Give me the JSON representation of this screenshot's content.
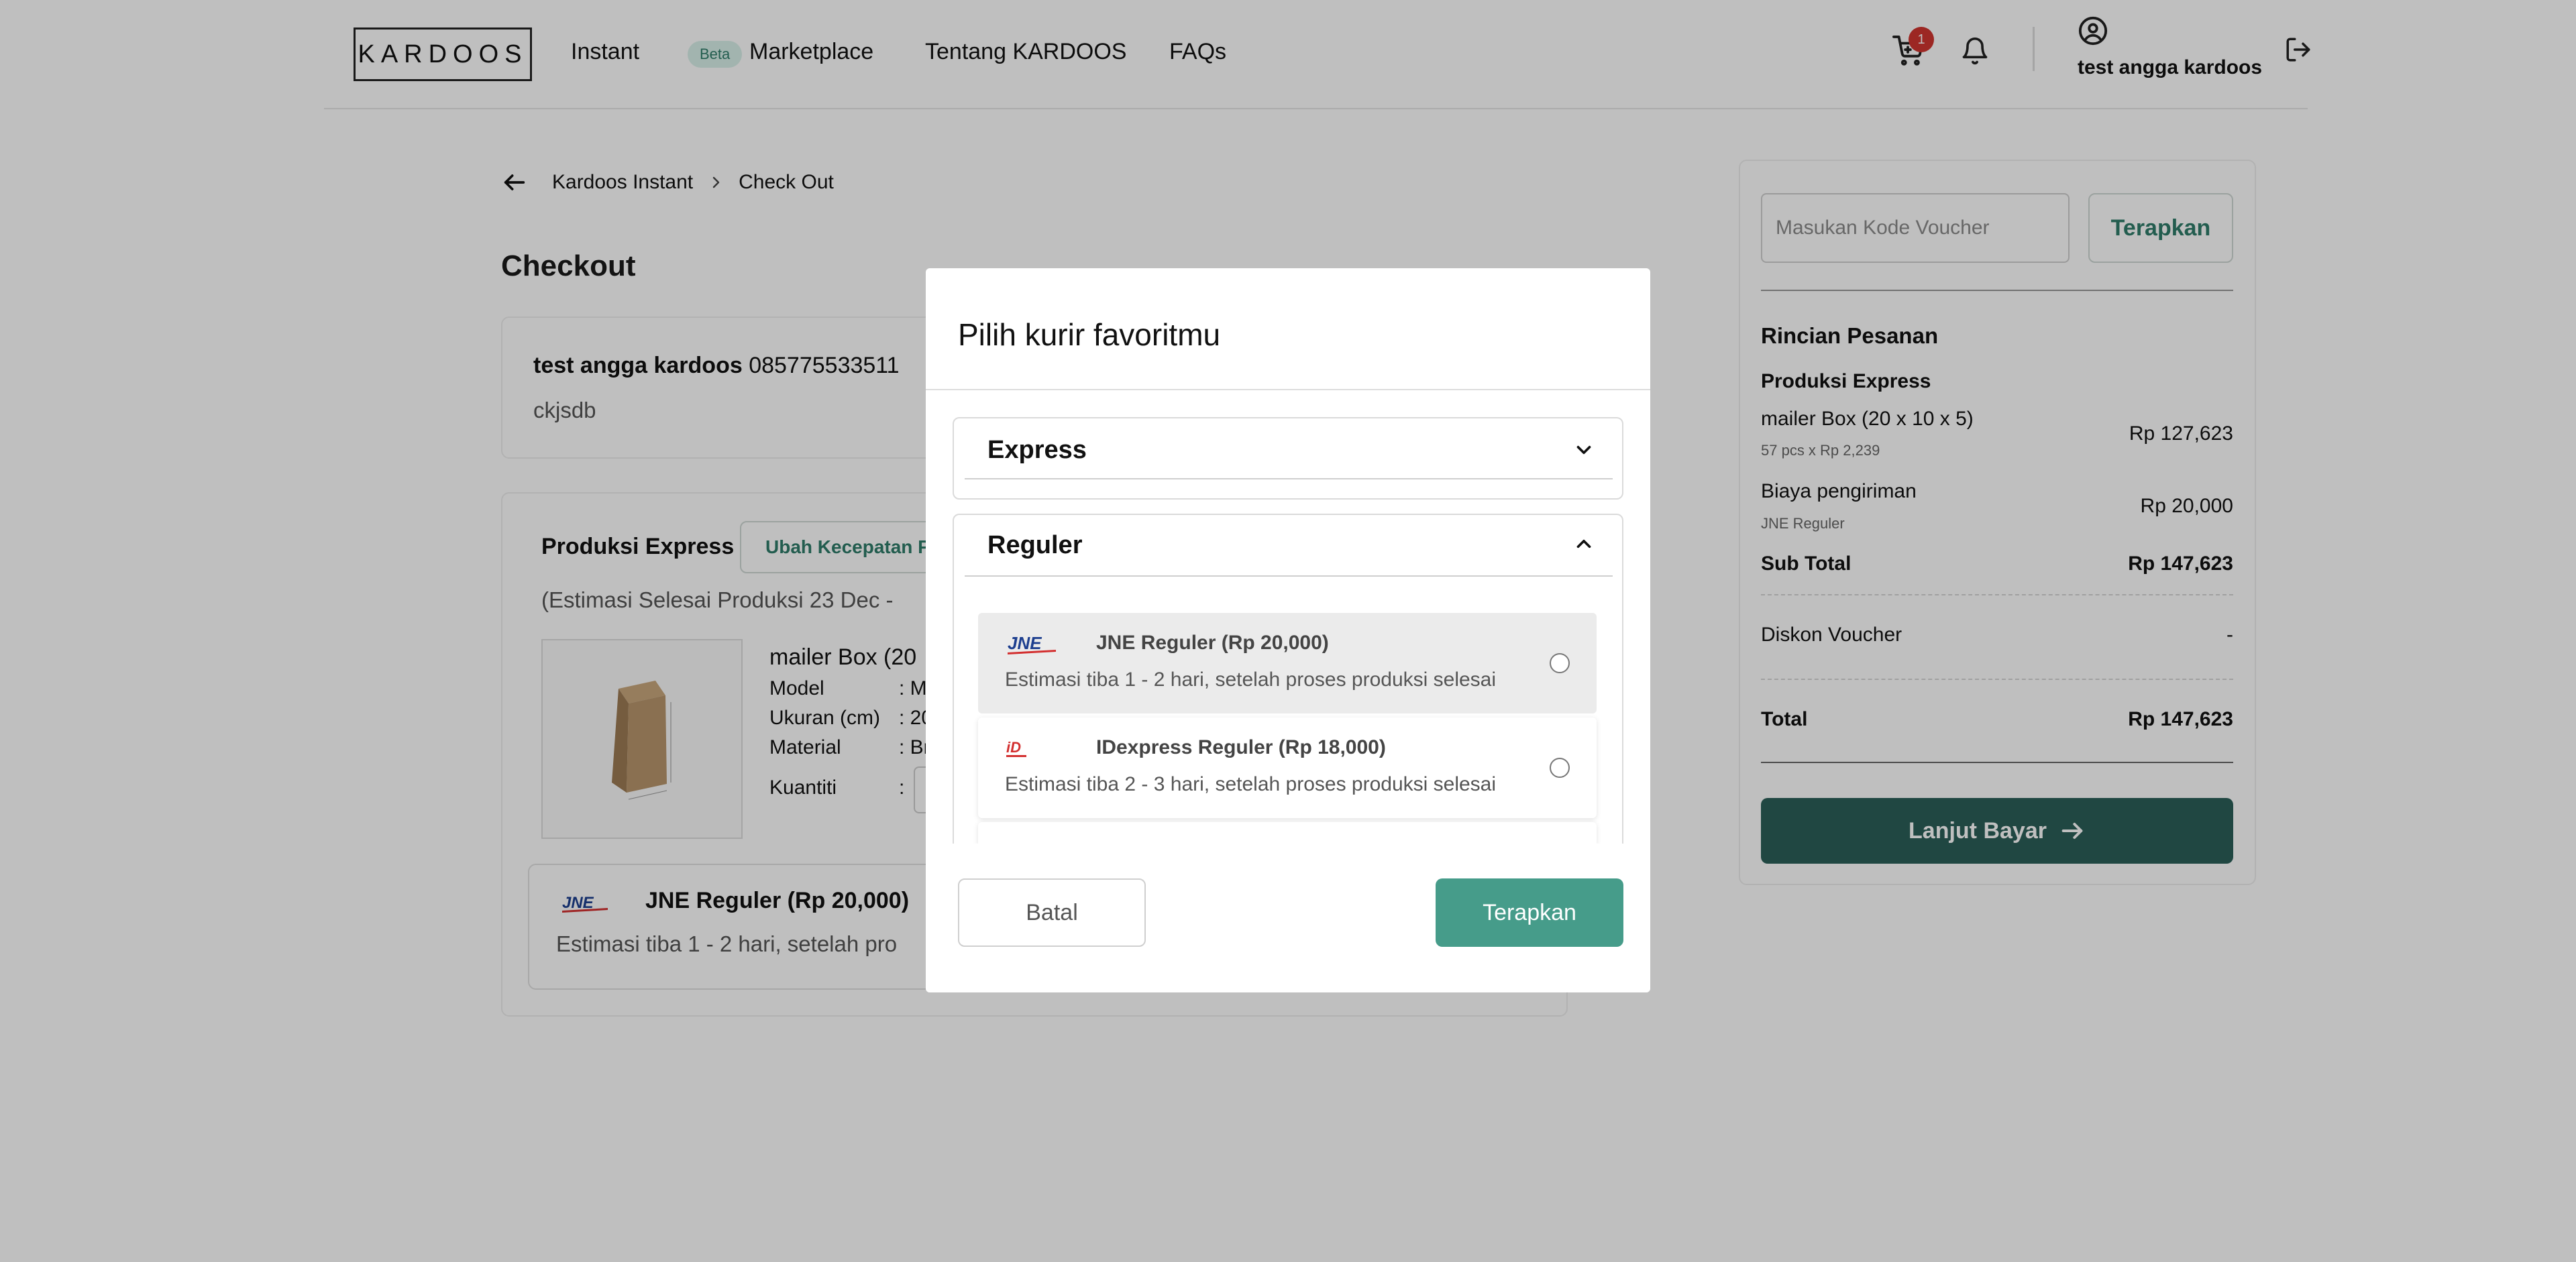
{
  "header": {
    "logo": "KARDOOS",
    "nav": [
      "Instant",
      "Marketplace",
      "Tentang KARDOOS",
      "FAQs"
    ],
    "beta_badge": "Beta",
    "cart_count": "1",
    "user_name": "test angga kardoos"
  },
  "breadcrumb": {
    "items": [
      "Kardoos Instant",
      "Check Out"
    ]
  },
  "checkout": {
    "title": "Checkout",
    "address": {
      "name": "test angga kardoos",
      "phone": "085775533511",
      "detail": "ckjsdb"
    },
    "production": {
      "label": "Produksi Express",
      "change_speed_label": "Ubah Kecepatan P",
      "estimate": "(Estimasi Selesai Produksi 23 Dec  -",
      "item": {
        "title": "mailer Box (20",
        "specs": [
          {
            "label": "Model",
            "value": ": M"
          },
          {
            "label": "Ukuran (cm)",
            "value": ": 20"
          },
          {
            "label": "Material",
            "value": ": Br"
          },
          {
            "label": "Kuantiti",
            "value": ":"
          }
        ]
      }
    },
    "selected_courier": {
      "name": "JNE Reguler  (Rp 20,000)",
      "estimate": "Estimasi tiba 1  -  2 hari, setelah pro"
    }
  },
  "summary": {
    "voucher_placeholder": "Masukan Kode Voucher",
    "voucher_apply": "Terapkan",
    "title": "Rincian Pesanan",
    "section": "Produksi Express",
    "product_name": "mailer Box (20 x 10 x 5)",
    "product_qty": "57 pcs x Rp 2,239",
    "product_price": "Rp 127,623",
    "shipping_label": "Biaya pengiriman",
    "shipping_courier": "JNE Reguler",
    "shipping_price": "Rp 20,000",
    "subtotal_label": "Sub Total",
    "subtotal": "Rp 147,623",
    "discount_label": "Diskon Voucher",
    "discount": "-",
    "total_label": "Total",
    "total": "Rp 147,623",
    "pay_label": "Lanjut Bayar"
  },
  "modal": {
    "title": "Pilih kurir favoritmu",
    "groups": [
      "Express",
      "Reguler"
    ],
    "options": [
      {
        "name": "JNE Reguler (Rp 20,000)",
        "estimate": "Estimasi tiba 1  -  2 hari, setelah proses produksi selesai"
      },
      {
        "name": "IDexpress Reguler (Rp 18,000)",
        "estimate": "Estimasi tiba 2  -  3 hari, setelah proses produksi selesai"
      }
    ],
    "cancel_label": "Batal",
    "apply_label": "Terapkan"
  },
  "colors": {
    "accent": "#469c8a",
    "pay_button": "#2b5f58",
    "badge": "#d1342f"
  }
}
